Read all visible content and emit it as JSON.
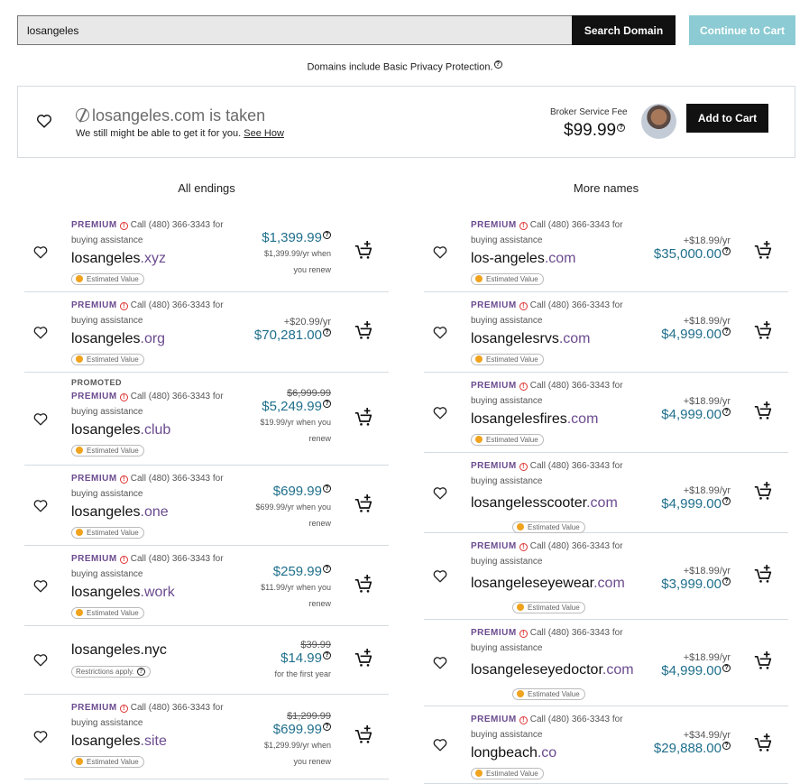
{
  "search": {
    "value": "losangeles",
    "button": "Search Domain",
    "continue": "Continue to Cart"
  },
  "privacy": "Domains include Basic Privacy Protection.",
  "taken": {
    "title": "losangeles.com is taken",
    "sub": "We still might be able to get it for you.",
    "link": "See How",
    "broker_label": "Broker Service Fee",
    "broker_price": "$99.99",
    "add_button": "Add to Cart"
  },
  "columns": {
    "left": "All endings",
    "right": "More names"
  },
  "premium_label": "PREMIUM",
  "premium_note_1": "Call (480) 366-3343 for",
  "premium_note_2": "buying assistance",
  "estimated": "Estimated Value",
  "left_rows": [
    {
      "name": "losangeles",
      "tld": ".xyz",
      "price": "$1,399.99",
      "renew1": "$1,399.99/yr when",
      "renew2": "you renew"
    },
    {
      "name": "losangeles",
      "tld": ".org",
      "plus": "+$20.99/yr",
      "price": "$70,281.00"
    },
    {
      "promoted": "PROMOTED",
      "name": "losangeles",
      "tld": ".club",
      "strike": "$6,999.99",
      "price": "$5,249.99",
      "renew1": "$19.99/yr when you",
      "renew2": "renew"
    },
    {
      "name": "losangeles",
      "tld": ".one",
      "price": "$699.99",
      "renew1": "$699.99/yr when you",
      "renew2": "renew"
    },
    {
      "name": "losangeles",
      "tld": ".work",
      "price": "$259.99",
      "renew1": "$11.99/yr when you",
      "renew2": "renew"
    },
    {
      "name": "losangeles.nyc",
      "restrict": "Restrictions apply.",
      "strike": "$39.99",
      "price": "$14.99",
      "renew1": "for the first year"
    },
    {
      "name": "losangeles",
      "tld": ".site",
      "strike": "$1,299.99",
      "price": "$699.99",
      "renew1": "$1,299.99/yr when",
      "renew2": "you renew"
    }
  ],
  "right_rows": [
    {
      "name": "los-angeles",
      "tld": ".com",
      "plus": "+$18.99/yr",
      "price": "$35,000.00"
    },
    {
      "name": "losangelesrvs",
      "tld": ".com",
      "plus": "+$18.99/yr",
      "price": "$4,999.00"
    },
    {
      "name": "losangelesfires",
      "tld": ".com",
      "plus": "+$18.99/yr",
      "price": "$4,999.00"
    },
    {
      "name": "losangelesscooter",
      "tld": ".com",
      "plus": "+$18.99/yr",
      "price": "$4,999.00"
    },
    {
      "name": "losangeleseyewear",
      "tld": ".com",
      "plus": "+$18.99/yr",
      "price": "$3,999.00"
    },
    {
      "name": "losangeleseyedoctor",
      "tld": ".com",
      "plus": "+$18.99/yr",
      "price": "$4,999.00"
    },
    {
      "name": "longbeach",
      "tld": ".co",
      "plus": "+$34.99/yr",
      "price": "$29,888.00"
    }
  ]
}
